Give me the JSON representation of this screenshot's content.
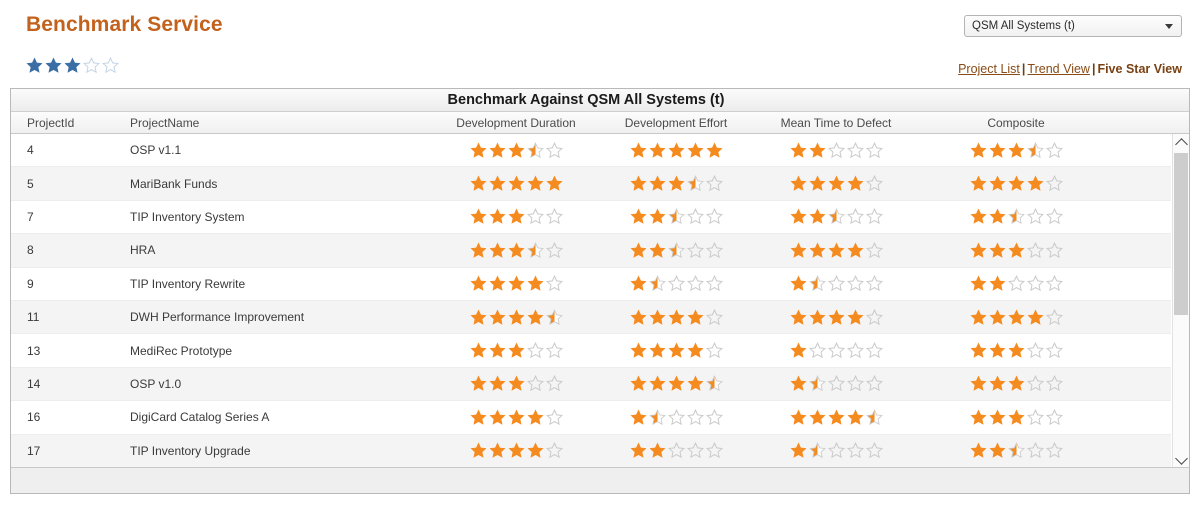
{
  "header": {
    "app_title": "Benchmark Service",
    "system_select": {
      "value": "QSM All Systems (t)",
      "arrow_icon": "chevron-down-icon"
    },
    "overall_rating": 3,
    "overall_rating_max": 5
  },
  "nav": {
    "project_list": "Project List",
    "separator": "|",
    "trend_view": "Trend View",
    "five_star_view": "Five Star View",
    "current": "Five Star View"
  },
  "table": {
    "title": "Benchmark Against QSM All Systems (t)",
    "columns": [
      "ProjectId",
      "ProjectName",
      "Development Duration",
      "Development Effort",
      "Mean Time to Defect",
      "Composite"
    ],
    "rows": [
      {
        "id": "4",
        "name": "OSP v1.1",
        "development_duration": 3.5,
        "development_effort": 5.0,
        "mean_time_to_defect": 2.0,
        "composite": 3.5
      },
      {
        "id": "5",
        "name": "MariBank Funds",
        "development_duration": 5.0,
        "development_effort": 3.5,
        "mean_time_to_defect": 4.0,
        "composite": 4.0
      },
      {
        "id": "7",
        "name": "TIP Inventory System",
        "development_duration": 3.0,
        "development_effort": 2.5,
        "mean_time_to_defect": 2.5,
        "composite": 2.5
      },
      {
        "id": "8",
        "name": "HRA",
        "development_duration": 3.5,
        "development_effort": 2.5,
        "mean_time_to_defect": 4.0,
        "composite": 3.0
      },
      {
        "id": "9",
        "name": "TIP Inventory Rewrite",
        "development_duration": 4.0,
        "development_effort": 1.5,
        "mean_time_to_defect": 1.5,
        "composite": 2.0
      },
      {
        "id": "11",
        "name": "DWH Performance Improvement",
        "development_duration": 4.5,
        "development_effort": 4.0,
        "mean_time_to_defect": 4.0,
        "composite": 4.0
      },
      {
        "id": "13",
        "name": "MediRec Prototype",
        "development_duration": 3.0,
        "development_effort": 4.0,
        "mean_time_to_defect": 1.0,
        "composite": 3.0
      },
      {
        "id": "14",
        "name": "OSP v1.0",
        "development_duration": 3.0,
        "development_effort": 4.5,
        "mean_time_to_defect": 1.5,
        "composite": 3.0
      },
      {
        "id": "16",
        "name": "DigiCard Catalog Series A",
        "development_duration": 4.0,
        "development_effort": 1.5,
        "mean_time_to_defect": 4.5,
        "composite": 3.0
      },
      {
        "id": "17",
        "name": "TIP Inventory Upgrade",
        "development_duration": 4.0,
        "development_effort": 2.0,
        "mean_time_to_defect": 1.5,
        "composite": 2.5
      }
    ],
    "star_max": 5
  },
  "scrollbar": {
    "up_icon": "chevron-up-icon",
    "down_icon": "chevron-down-icon",
    "thumb_fraction": 0.54
  },
  "colors": {
    "title": "#c3621d",
    "star_filled": "#f58a1f",
    "star_empty_stroke": "#c9c9c9",
    "blue_star_filled": "#3a6ea5",
    "blue_star_empty": "#c3d4e6",
    "link": "#8a4b16"
  }
}
